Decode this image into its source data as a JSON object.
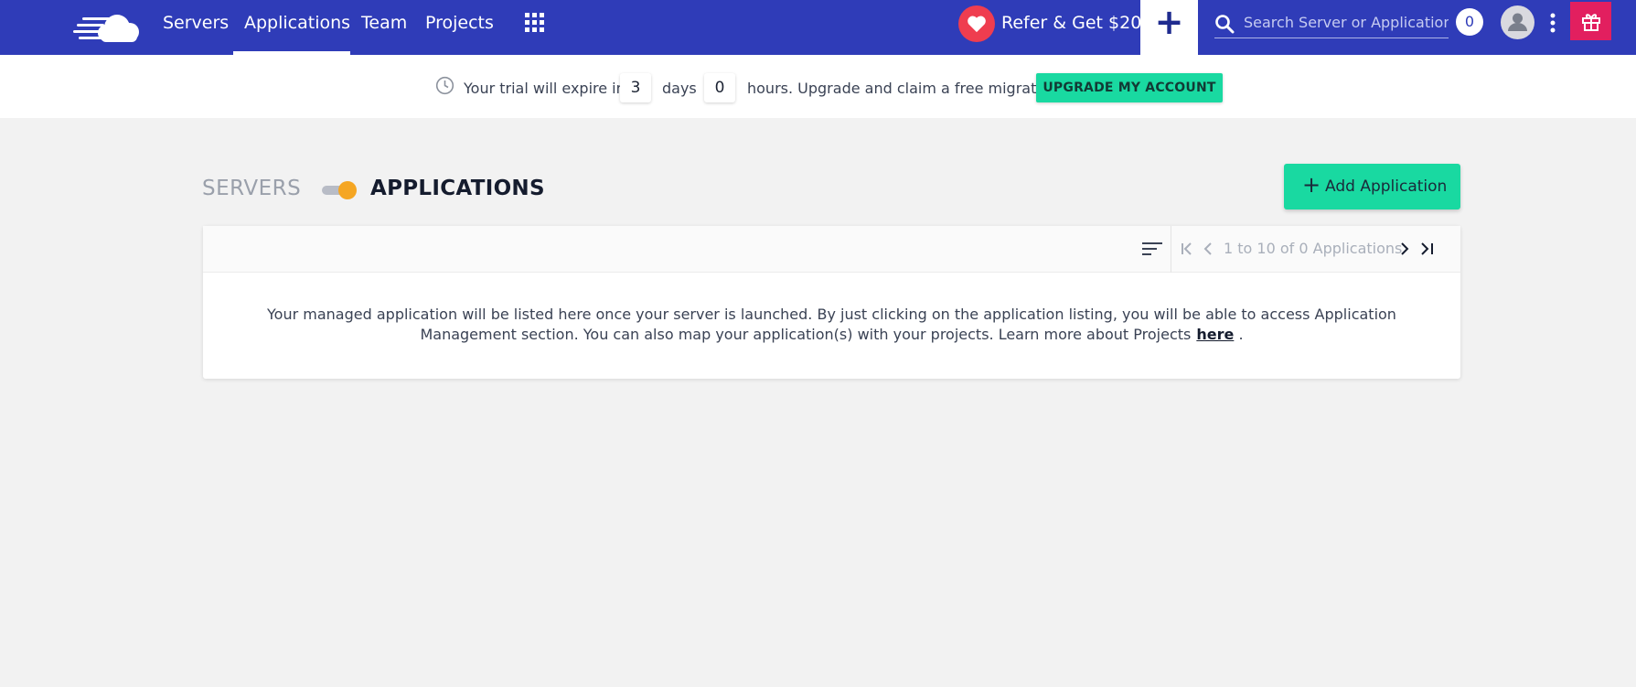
{
  "nav": {
    "links": [
      "Servers",
      "Applications",
      "Team",
      "Projects"
    ],
    "active": "Applications",
    "refer_label": "Refer & Get $20",
    "search_placeholder": "Search Server or Application",
    "notification_count": "0",
    "brand_color": "#2f3cb8"
  },
  "trial": {
    "prefix": "Your trial will expire in",
    "days": "3",
    "days_label": "days",
    "hours": "0",
    "suffix": "hours. Upgrade and claim a free migration",
    "upgrade_label": "UPGRADE MY ACCOUNT"
  },
  "header": {
    "servers_label": "SERVERS",
    "applications_label": "APPLICATIONS",
    "toggle_state": "applications",
    "add_label": "Add Application",
    "accent_color": "#19d9a1"
  },
  "table": {
    "pagination": "1 to 10 of 0 Applications",
    "empty_message": "Your managed application will be listed here once your server is launched. By just clicking on the application listing, you will be able to access Application Management section. You can also map your application(s) with your projects. Learn more about Projects",
    "link_label": "here",
    "trailing": "."
  },
  "icons": [
    "cloud-logo-icon",
    "apps-grid-icon",
    "heart-icon",
    "plus-icon",
    "search-icon",
    "user-icon",
    "kebab-menu-icon",
    "gift-icon",
    "clock-icon",
    "sort-icon",
    "first-page-icon",
    "prev-page-icon",
    "next-page-icon",
    "last-page-icon"
  ]
}
